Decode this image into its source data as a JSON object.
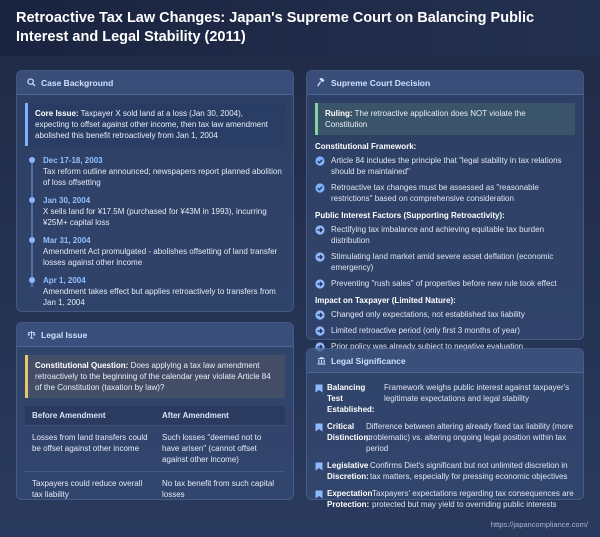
{
  "title": "Retroactive Tax Law Changes: Japan's Supreme Court on Balancing Public Interest and Legal Stability (2011)",
  "case_background": {
    "heading": "Case Background",
    "core_issue_label": "Core Issue:",
    "core_issue_text": "Taxpayer X sold land at a loss (Jan 30, 2004), expecting to offset against other income, then tax law amendment abolished this benefit retroactively from Jan 1, 2004",
    "timeline": [
      {
        "date": "Dec 17-18, 2003",
        "text": "Tax reform outline announced; newspapers report planned abolition of loss offsetting"
      },
      {
        "date": "Jan 30, 2004",
        "text": "X sells land for ¥17.5M (purchased for ¥43M in 1993), incurring ¥25M+ capital loss"
      },
      {
        "date": "Mar 31, 2004",
        "text": "Amendment Act promulgated - abolishes offsetting of land transfer losses against other income"
      },
      {
        "date": "Apr 1, 2004",
        "text": "Amendment takes effect but applies retroactively to transfers from Jan 1, 2004"
      }
    ]
  },
  "legal_issue": {
    "heading": "Legal Issue",
    "question_label": "Constitutional Question:",
    "question_text": "Does applying a tax law amendment retroactively to the beginning of the calendar year violate Article 84 of the Constitution (taxation by law)?",
    "table_headers": [
      "Before Amendment",
      "After Amendment"
    ],
    "table_rows": [
      [
        "Losses from land transfers could be offset against other income",
        "Such losses \"deemed not to have arisen\" (cannot offset against other income)"
      ],
      [
        "Taxpayers could reduce overall tax liability",
        "No tax benefit from such capital losses"
      ]
    ]
  },
  "decision": {
    "heading": "Supreme Court Decision",
    "ruling_label": "Ruling:",
    "ruling_text": "The retroactive application does NOT violate the Constitution",
    "framework_heading": "Constitutional Framework:",
    "framework_items": [
      "Article 84 includes the principle that \"legal stability in tax relations should be maintained\"",
      "Retroactive tax changes must be assessed as \"reasonable restrictions\" based on comprehensive consideration"
    ],
    "public_heading": "Public Interest Factors (Supporting Retroactivity):",
    "public_items": [
      "Rectifying tax imbalance and achieving equitable tax burden distribution",
      "Stimulating land market amid severe asset deflation (economic emergency)",
      "Preventing \"rush sales\" of properties before new rule took effect"
    ],
    "impact_heading": "Impact on Taxpayer (Limited Nature):",
    "impact_items": [
      "Changed only expectations, not established tax liability",
      "Limited retroactive period (only first 3 months of year)",
      "Prior policy was already subject to negative evaluation"
    ]
  },
  "significance": {
    "heading": "Legal Significance",
    "items": [
      {
        "term": "Balancing Test Established:",
        "text": "Framework weighs public interest against taxpayer's legitimate expectations and legal stability"
      },
      {
        "term": "Critical Distinction:",
        "text": "Difference between altering already fixed tax liability (more problematic) vs. altering ongoing legal position within tax period"
      },
      {
        "term": "Legislative Discretion:",
        "text": "Confirms Diet's significant but not unlimited discretion in tax matters, especially for pressing economic objectives"
      },
      {
        "term": "Expectation Protection:",
        "text": "Taxpayers' expectations regarding tax consequences are protected but may yield to overriding public interests"
      }
    ]
  },
  "footer": "https://japancompliance.com/",
  "colors": {
    "accent_blue": "#8fc0ff",
    "check_green": "#7fd6a0",
    "arrow_blue": "#8fb8ff",
    "callout_yellow": "#e7c76a"
  }
}
